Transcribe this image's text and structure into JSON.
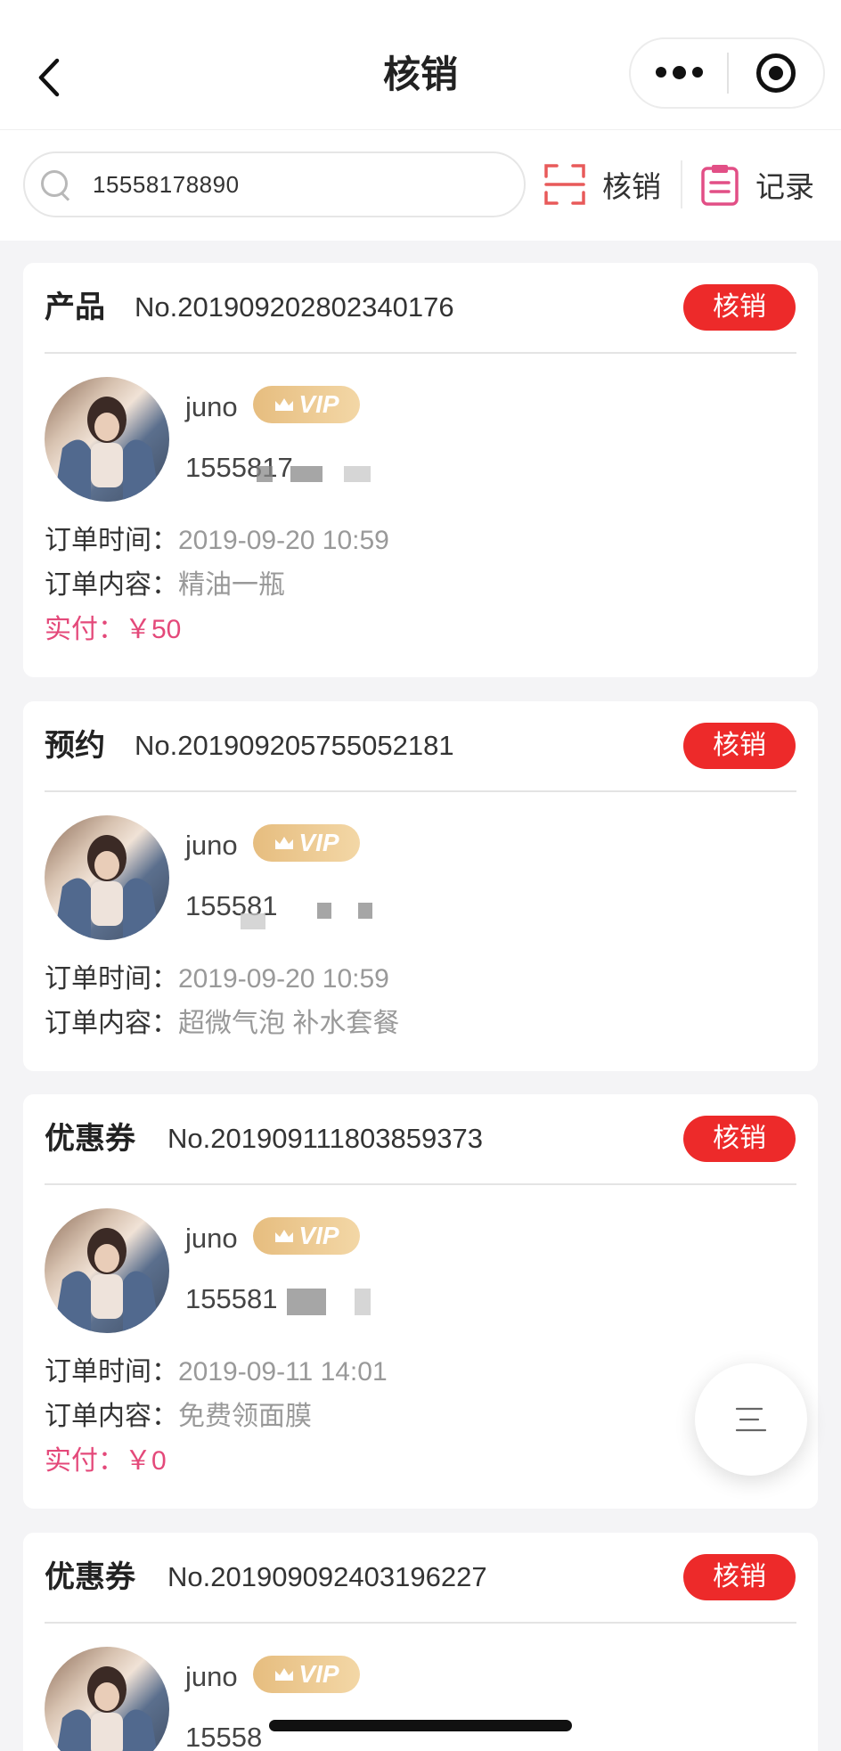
{
  "nav": {
    "title": "核销",
    "back_icon": "chevron-left-icon",
    "more_icon": "more-dots-icon",
    "close_icon": "target-circle-icon"
  },
  "search": {
    "value": "15558178890",
    "icon": "search-icon"
  },
  "toolbar": {
    "scan_label": "核销",
    "scan_icon": "scan-frame-icon",
    "record_label": "记录",
    "record_icon": "clipboard-icon"
  },
  "labels": {
    "order_time": "订单时间：",
    "order_content": "订单内容：",
    "paid": "实付：",
    "verify_button": "核销",
    "vip": "VIP"
  },
  "colors": {
    "accent_red": "#ed2a2a",
    "pay_pink": "#e4497a",
    "vip_gold": "#e6bd7f"
  },
  "orders": [
    {
      "type": "产品",
      "number": "No.201909202802340176",
      "username": "juno",
      "phone": "1555817",
      "time": "2019-09-20 10:59",
      "content": "精油一瓶",
      "paid": "￥50"
    },
    {
      "type": "预约",
      "number": "No.201909205755052181",
      "username": "juno",
      "phone": "155581",
      "time": "2019-09-20 10:59",
      "content": "超微气泡 补水套餐",
      "paid": null
    },
    {
      "type": "优惠券",
      "number": "No.201909111803859373",
      "username": "juno",
      "phone": "155581",
      "time": "2019-09-11 14:01",
      "content": "免费领面膜",
      "paid": "￥0"
    },
    {
      "type": "优惠券",
      "number": "No.201909092403196227",
      "username": "juno",
      "phone": "15558",
      "time": "",
      "content": "",
      "paid": null
    }
  ],
  "fab_icon": "menu-lines-icon"
}
